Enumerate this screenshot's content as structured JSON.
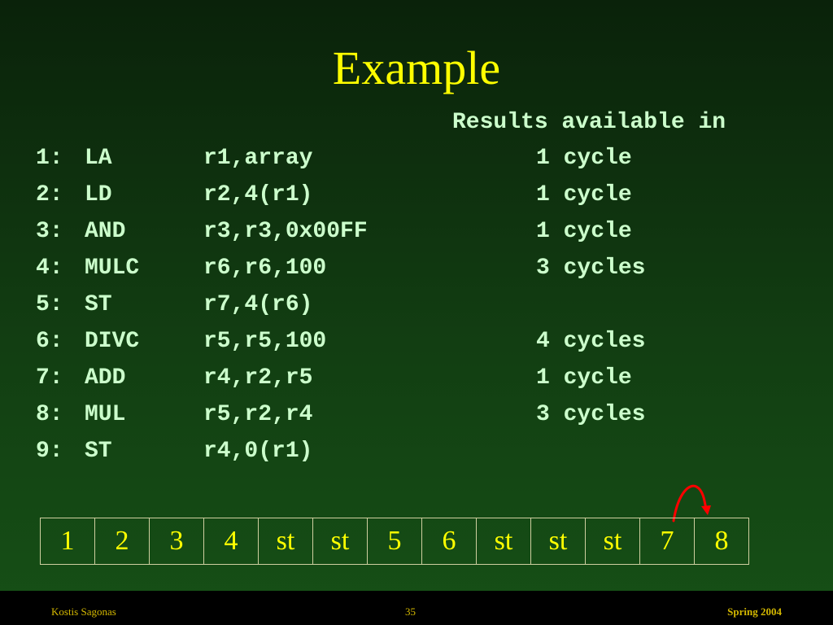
{
  "slide": {
    "title": "Example",
    "results_header": "Results available in"
  },
  "instructions": [
    {
      "num": "1:",
      "op": "LA",
      "args": "r1,array",
      "latency": "1 cycle"
    },
    {
      "num": "2:",
      "op": "LD",
      "args": "r2,4(r1)",
      "latency": "1 cycle"
    },
    {
      "num": "3:",
      "op": "AND",
      "args": "r3,r3,0x00FF",
      "latency": "1 cycle"
    },
    {
      "num": "4:",
      "op": "MULC",
      "args": "r6,r6,100",
      "latency": "3 cycles"
    },
    {
      "num": "5:",
      "op": "ST",
      "args": "r7,4(r6)",
      "latency": ""
    },
    {
      "num": "6:",
      "op": "DIVC",
      "args": "r5,r5,100",
      "latency": "4 cycles"
    },
    {
      "num": "7:",
      "op": "ADD",
      "args": "r4,r2,r5",
      "latency": "1 cycle"
    },
    {
      "num": "8:",
      "op": "MUL",
      "args": "r5,r2,r4",
      "latency": "3 cycles"
    },
    {
      "num": "9:",
      "op": "ST",
      "args": "r4,0(r1)",
      "latency": ""
    }
  ],
  "pipeline": [
    "1",
    "2",
    "3",
    "4",
    "st",
    "st",
    "5",
    "6",
    "st",
    "st",
    "st",
    "7",
    "8"
  ],
  "footer": {
    "author": "Kostis Sagonas",
    "page": "35",
    "term": "Spring 2004"
  },
  "colors": {
    "title": "#ffff00",
    "code": "#ccffcc",
    "pipeline_text": "#ffff00",
    "arrow": "#ff0000",
    "footer_text": "#d4b800"
  }
}
